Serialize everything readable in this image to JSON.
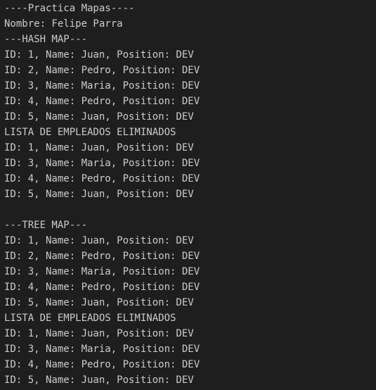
{
  "terminal": {
    "background_color": "#1e1e1e",
    "text_color": "#cccccc",
    "lines": [
      "----Practica Mapas----",
      "Nombre: Felipe Parra",
      "---HASH MAP---",
      "ID: 1, Name: Juan, Position: DEV",
      "ID: 2, Name: Pedro, Position: DEV",
      "ID: 3, Name: Maria, Position: DEV",
      "ID: 4, Name: Pedro, Position: DEV",
      "ID: 5, Name: Juan, Position: DEV",
      "LISTA DE EMPLEADOS ELIMINADOS",
      "ID: 1, Name: Juan, Position: DEV",
      "ID: 3, Name: Maria, Position: DEV",
      "ID: 4, Name: Pedro, Position: DEV",
      "ID: 5, Name: Juan, Position: DEV",
      "",
      "---TREE MAP---",
      "ID: 1, Name: Juan, Position: DEV",
      "ID: 2, Name: Pedro, Position: DEV",
      "ID: 3, Name: Maria, Position: DEV",
      "ID: 4, Name: Pedro, Position: DEV",
      "ID: 5, Name: Juan, Position: DEV",
      "LISTA DE EMPLEADOS ELIMINADOS",
      "ID: 1, Name: Juan, Position: DEV",
      "ID: 3, Name: Maria, Position: DEV",
      "ID: 4, Name: Pedro, Position: DEV",
      "ID: 5, Name: Juan, Position: DEV"
    ]
  }
}
